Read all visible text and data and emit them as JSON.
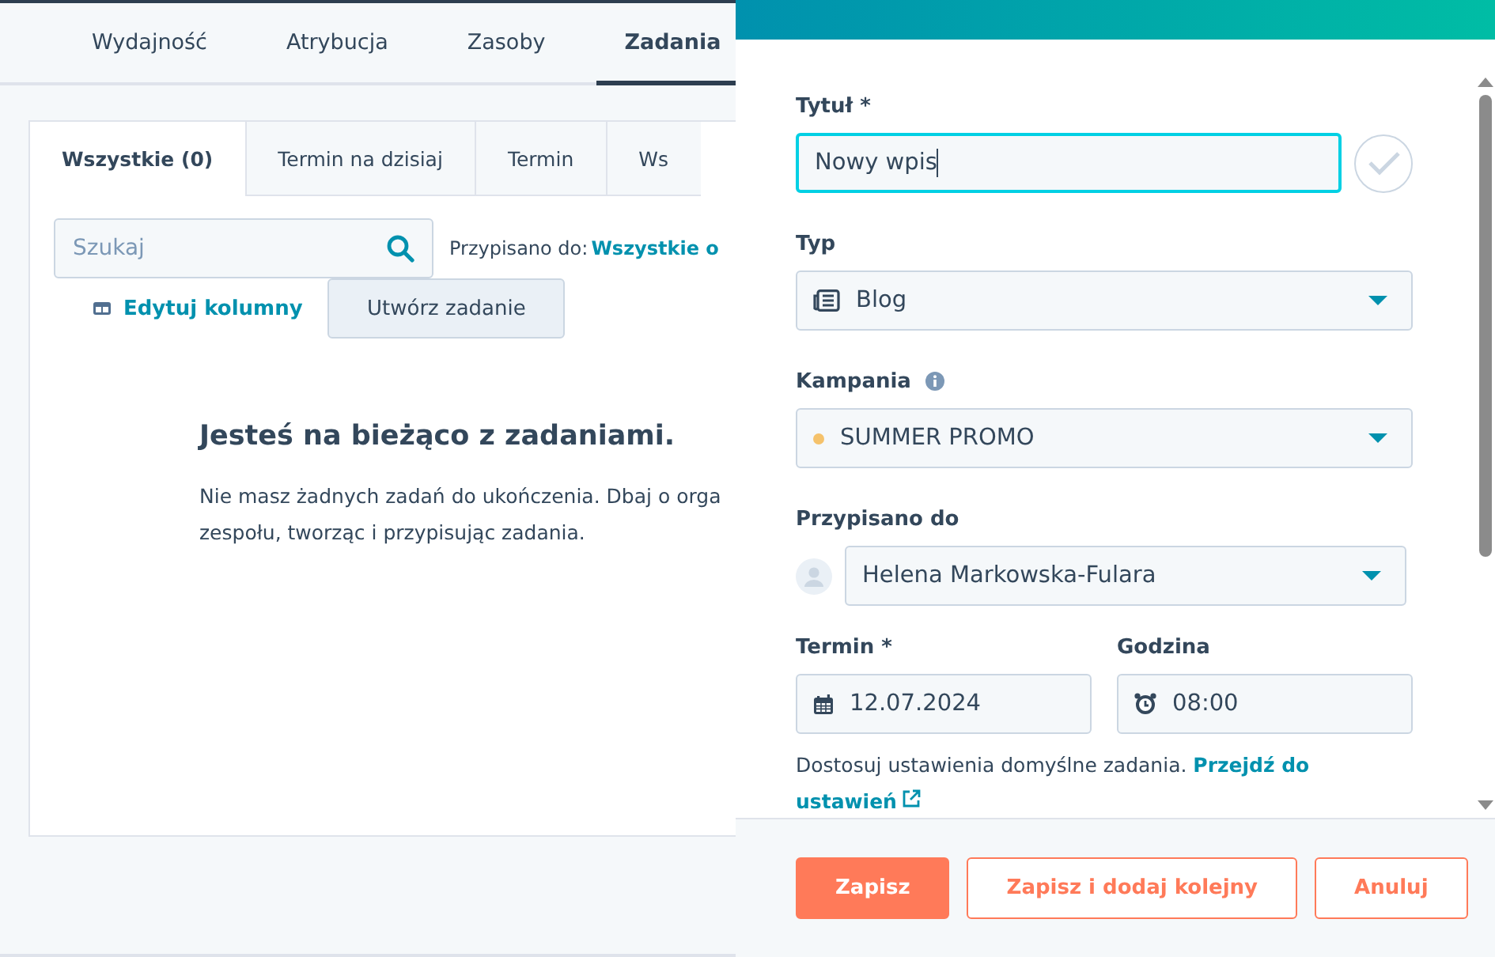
{
  "nav_tabs": [
    {
      "label": "Wydajność",
      "selected": false
    },
    {
      "label": "Atrybucja",
      "selected": false
    },
    {
      "label": "Zasoby",
      "selected": false
    },
    {
      "label": "Zadania",
      "selected": true
    }
  ],
  "task_tabs": [
    {
      "label": "Wszystkie (0)",
      "selected": true
    },
    {
      "label": "Termin na dzisiaj",
      "selected": false
    },
    {
      "label": "Termin",
      "selected": false
    },
    {
      "label": "Ws",
      "selected": false
    }
  ],
  "search": {
    "placeholder": "Szukaj"
  },
  "assigned_filter": {
    "label": "Przypisano do:",
    "value": "Wszystkie o"
  },
  "edit_columns": "Edytuj kolumny",
  "create_task": "Utwórz zadanie",
  "empty_state": {
    "title": "Jesteś na bieżąco z zadaniami.",
    "lines": [
      "Nie masz żadnych zadań do ukończenia. Dbaj o orga",
      "zespołu, tworząc i przypisując zadania."
    ]
  },
  "panel": {
    "title_field": {
      "label": "Tytuł *",
      "value": "Nowy wpis"
    },
    "type_field": {
      "label": "Typ",
      "value": "Blog"
    },
    "campaign_field": {
      "label": "Kampania",
      "value": "SUMMER PROMO",
      "color": "#f5c26b"
    },
    "assignee_field": {
      "label": "Przypisano do",
      "value": "Helena Markowska-Fulara"
    },
    "date_field": {
      "label": "Termin *",
      "value": "12.07.2024"
    },
    "time_field": {
      "label": "Godzina",
      "value": "08:00"
    },
    "hint": {
      "text": "Dostosuj ustawienia domyślne zadania.",
      "link_lines": [
        "Przejdź do",
        "ustawień"
      ]
    },
    "buttons": [
      {
        "label": "Zapisz",
        "kind": "primary"
      },
      {
        "label": "Zapisz i dodaj kolejny",
        "kind": "secondary"
      },
      {
        "label": "Anuluj",
        "kind": "secondary"
      }
    ]
  }
}
